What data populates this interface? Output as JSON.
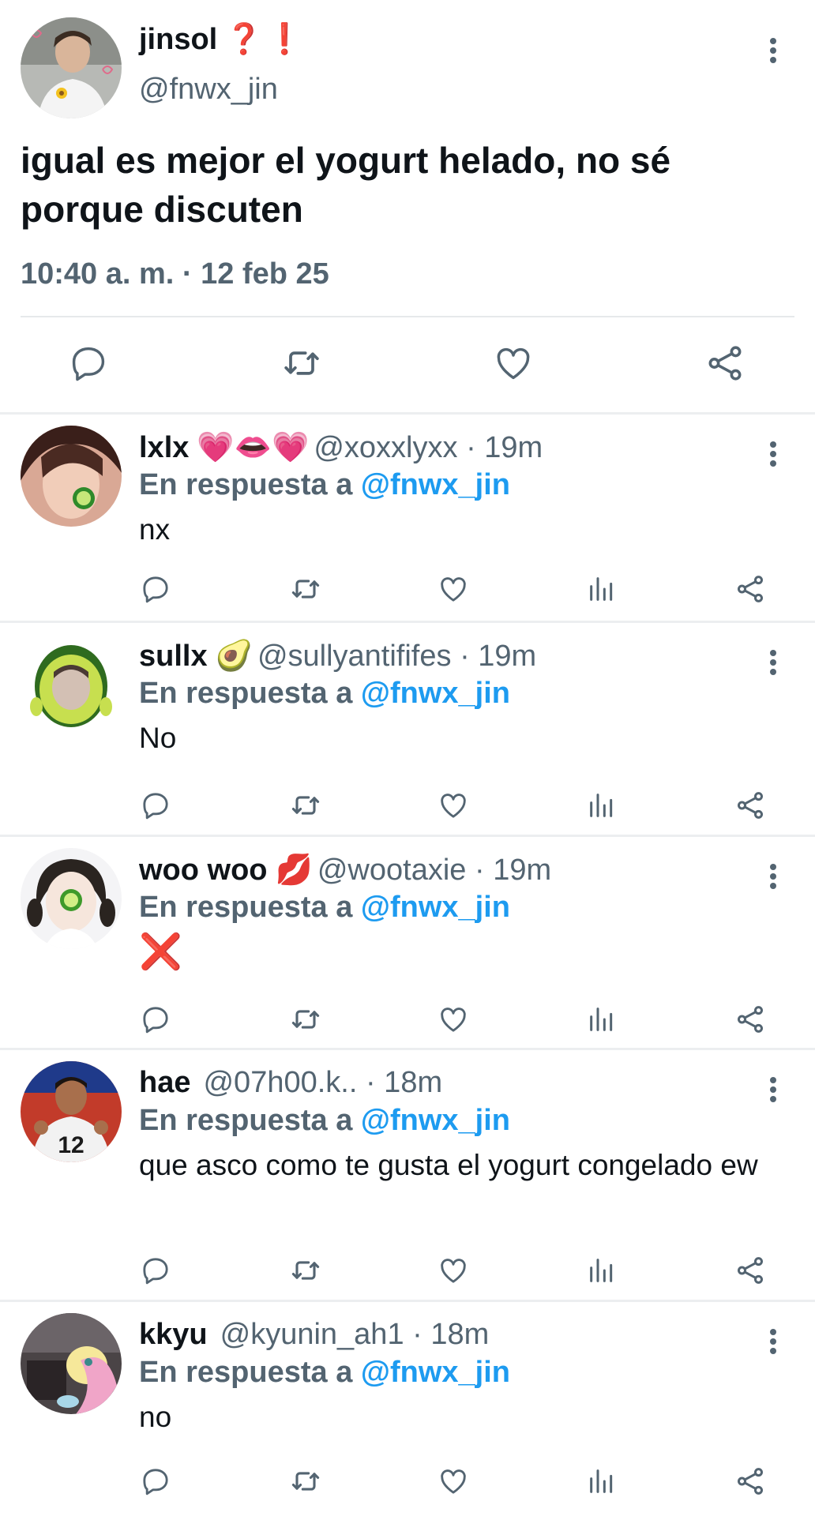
{
  "main_tweet": {
    "display_name": "jinsol",
    "name_marks": "❓❗",
    "handle": "@fnwx_jin",
    "text": "igual es mejor el yogurt helado, no sé porque discuten",
    "timestamp": "10:40 a. m. · 12 feb 25"
  },
  "replies": [
    {
      "display_name": "lxlx",
      "name_emoji": "💗👄💗",
      "handle": "@xoxxlyxx",
      "time": "· 19m",
      "replying_prefix": "En respuesta a ",
      "replying_to": "@fnwx_jin",
      "text": "nx"
    },
    {
      "display_name": "sullx",
      "name_emoji": "🥑",
      "handle": "@sullyantififes",
      "time": "· 19m",
      "replying_prefix": "En respuesta a ",
      "replying_to": "@fnwx_jin",
      "text": "No"
    },
    {
      "display_name": "woo woo",
      "name_emoji": "💋",
      "handle": "@wootaxie",
      "time": "· 19m",
      "replying_prefix": "En respuesta a ",
      "replying_to": "@fnwx_jin",
      "text": "❌"
    },
    {
      "display_name": "hae",
      "name_emoji": "",
      "handle": "@07h00.k..",
      "time": "· 18m",
      "replying_prefix": "En respuesta a ",
      "replying_to": "@fnwx_jin",
      "text": "que asco como te gusta el yogurt congelado ew"
    },
    {
      "display_name": "kkyu",
      "name_emoji": "",
      "handle": "@kyunin_ah1",
      "time": "· 18m",
      "replying_prefix": "En respuesta a ",
      "replying_to": "@fnwx_jin",
      "text": "no"
    }
  ],
  "icons": {
    "reply": "reply-icon",
    "retweet": "retweet-icon",
    "like": "like-icon",
    "views": "views-icon",
    "share": "share-icon",
    "more": "more-vertical-icon"
  },
  "colors": {
    "link": "#1d9bf0",
    "secondary_text": "#536471",
    "icon": "#536471",
    "divider": "#eceef0"
  }
}
